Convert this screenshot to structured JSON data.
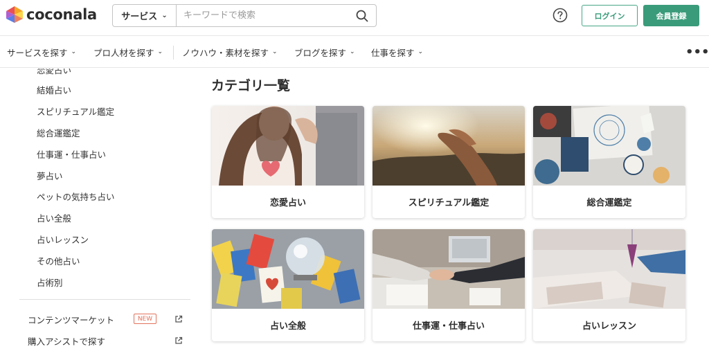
{
  "brand": {
    "name": "coconala"
  },
  "search": {
    "category_label": "サービス",
    "placeholder": "キーワードで検索"
  },
  "header": {
    "login_label": "ログイン",
    "signup_label": "会員登録"
  },
  "nav": {
    "items": [
      {
        "label": "サービスを探す"
      },
      {
        "label": "プロ人材を探す"
      },
      {
        "label": "ノウハウ・素材を探す"
      },
      {
        "label": "ブログを探す"
      },
      {
        "label": "仕事を探す"
      }
    ],
    "more_label": "•••"
  },
  "sidebar": {
    "items": [
      {
        "label": "恋愛占い"
      },
      {
        "label": "結婚占い"
      },
      {
        "label": "スピリチュアル鑑定"
      },
      {
        "label": "総合運鑑定"
      },
      {
        "label": "仕事運・仕事占い"
      },
      {
        "label": "夢占い"
      },
      {
        "label": "ペットの気持ち占い"
      },
      {
        "label": "占い全般"
      },
      {
        "label": "占いレッスン"
      },
      {
        "label": "その他占い"
      },
      {
        "label": "占術別"
      }
    ],
    "links": [
      {
        "label": "コンテンツマーケット",
        "badge": "NEW"
      },
      {
        "label": "購入アシストで探す"
      }
    ]
  },
  "main": {
    "title": "カテゴリ一覧",
    "cards": [
      {
        "label": "恋愛占い",
        "image": "woman-holding-heart"
      },
      {
        "label": "スピリチュアル鑑定",
        "image": "hands-toward-sky"
      },
      {
        "label": "総合運鑑定",
        "image": "astrology-desk"
      },
      {
        "label": "占い全般",
        "image": "tarot-cards-crystal-ball"
      },
      {
        "label": "仕事運・仕事占い",
        "image": "business-handshake"
      },
      {
        "label": "占いレッスン",
        "image": "pendulum-on-cards"
      }
    ]
  },
  "colors": {
    "accent": "#3a9b7a",
    "badge": "#e2725b"
  }
}
